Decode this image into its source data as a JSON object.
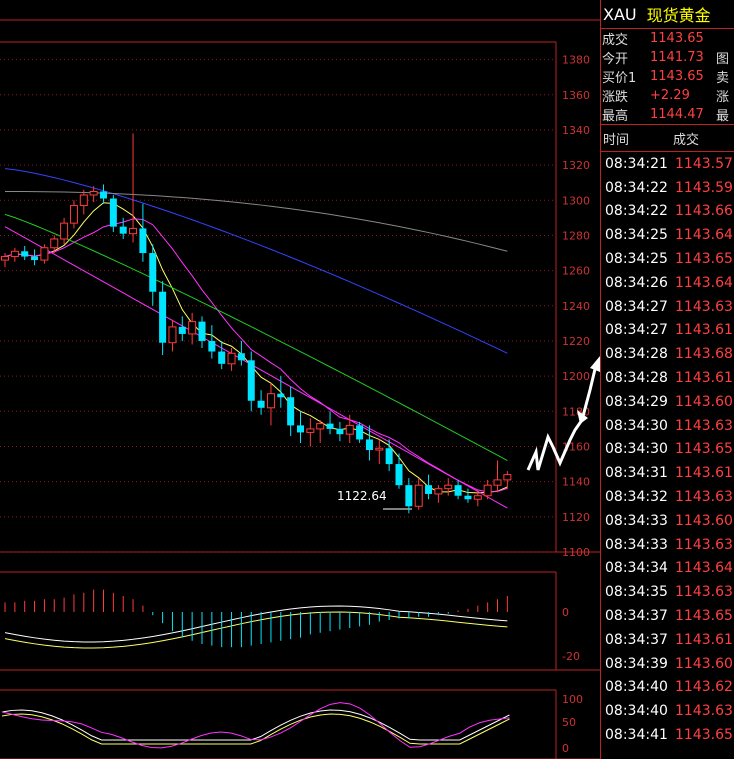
{
  "header": {
    "symbol": "XAU",
    "name": "现货黄金"
  },
  "quote": [
    {
      "label": "成交",
      "value": "1143.65",
      "cut": ""
    },
    {
      "label": "今开",
      "value": "1141.73",
      "cut": "图"
    },
    {
      "label": "买价1",
      "value": "1143.65",
      "cut": "卖"
    },
    {
      "label": "涨跌",
      "value": "+2.29",
      "cut": "涨"
    },
    {
      "label": "最高",
      "value": "1144.47",
      "cut": "最"
    }
  ],
  "ticks_header": {
    "time": "时间",
    "price": "成交"
  },
  "ticks": [
    {
      "time": "08:34:21",
      "price": "1143.57"
    },
    {
      "time": "08:34:22",
      "price": "1143.59"
    },
    {
      "time": "08:34:22",
      "price": "1143.66"
    },
    {
      "time": "08:34:25",
      "price": "1143.64"
    },
    {
      "time": "08:34:25",
      "price": "1143.65"
    },
    {
      "time": "08:34:26",
      "price": "1143.64"
    },
    {
      "time": "08:34:27",
      "price": "1143.63"
    },
    {
      "time": "08:34:27",
      "price": "1143.61"
    },
    {
      "time": "08:34:28",
      "price": "1143.68"
    },
    {
      "time": "08:34:28",
      "price": "1143.61"
    },
    {
      "time": "08:34:29",
      "price": "1143.60"
    },
    {
      "time": "08:34:30",
      "price": "1143.63"
    },
    {
      "time": "08:34:30",
      "price": "1143.65"
    },
    {
      "time": "08:34:31",
      "price": "1143.61"
    },
    {
      "time": "08:34:32",
      "price": "1143.63"
    },
    {
      "time": "08:34:33",
      "price": "1143.60"
    },
    {
      "time": "08:34:33",
      "price": "1143.63"
    },
    {
      "time": "08:34:34",
      "price": "1143.64"
    },
    {
      "time": "08:34:35",
      "price": "1143.63"
    },
    {
      "time": "08:34:37",
      "price": "1143.65"
    },
    {
      "time": "08:34:37",
      "price": "1143.61"
    },
    {
      "time": "08:34:39",
      "price": "1143.60"
    },
    {
      "time": "08:34:40",
      "price": "1143.62"
    },
    {
      "time": "08:34:40",
      "price": "1143.63"
    },
    {
      "time": "08:34:41",
      "price": "1143.65"
    }
  ],
  "chart": {
    "price_axis": [
      "1380",
      "1360",
      "1340",
      "1320",
      "1300",
      "1280",
      "1260",
      "1240",
      "1220",
      "1200",
      "1180",
      "1160",
      "1140",
      "1120",
      "1100"
    ],
    "low_label": "1122.64",
    "macd_axis": [
      "0",
      "-20"
    ],
    "kdj_axis": [
      "100",
      "50",
      "0"
    ],
    "colors": {
      "up": "#ff3b3b",
      "down": "#00e5ff",
      "ma5": "#ffffff",
      "ma10": "#ffff66",
      "ma20": "#ff33ff",
      "ma60": "#22cc22",
      "ma120": "#3344ff",
      "ma250": "#888888"
    }
  },
  "chart_data": {
    "type": "candlestick",
    "candles": [
      [
        1266,
        1270,
        1262,
        1268
      ],
      [
        1268,
        1273,
        1265,
        1271
      ],
      [
        1271,
        1274,
        1266,
        1268
      ],
      [
        1268,
        1272,
        1263,
        1266
      ],
      [
        1266,
        1275,
        1264,
        1273
      ],
      [
        1273,
        1280,
        1270,
        1278
      ],
      [
        1278,
        1290,
        1275,
        1287
      ],
      [
        1287,
        1300,
        1284,
        1297
      ],
      [
        1297,
        1306,
        1292,
        1303
      ],
      [
        1303,
        1308,
        1299,
        1305
      ],
      [
        1305,
        1309,
        1298,
        1301
      ],
      [
        1301,
        1303,
        1282,
        1285
      ],
      [
        1285,
        1290,
        1278,
        1281
      ],
      [
        1281,
        1338,
        1276,
        1284
      ],
      [
        1284,
        1298,
        1265,
        1270
      ],
      [
        1270,
        1275,
        1240,
        1248
      ],
      [
        1248,
        1254,
        1212,
        1219
      ],
      [
        1219,
        1232,
        1214,
        1228
      ],
      [
        1228,
        1234,
        1220,
        1224
      ],
      [
        1224,
        1236,
        1218,
        1231
      ],
      [
        1231,
        1234,
        1216,
        1220
      ],
      [
        1220,
        1229,
        1210,
        1214
      ],
      [
        1214,
        1220,
        1204,
        1207
      ],
      [
        1207,
        1216,
        1203,
        1213
      ],
      [
        1213,
        1220,
        1206,
        1209
      ],
      [
        1209,
        1214,
        1180,
        1186
      ],
      [
        1186,
        1192,
        1178,
        1182
      ],
      [
        1182,
        1196,
        1172,
        1190
      ],
      [
        1190,
        1200,
        1182,
        1188
      ],
      [
        1188,
        1194,
        1166,
        1172
      ],
      [
        1172,
        1180,
        1162,
        1168
      ],
      [
        1168,
        1176,
        1160,
        1170
      ],
      [
        1170,
        1175,
        1162,
        1173
      ],
      [
        1173,
        1180,
        1167,
        1170
      ],
      [
        1170,
        1174,
        1163,
        1167
      ],
      [
        1167,
        1178,
        1162,
        1172
      ],
      [
        1172,
        1174,
        1162,
        1164
      ],
      [
        1164,
        1172,
        1152,
        1158
      ],
      [
        1158,
        1164,
        1150,
        1159
      ],
      [
        1159,
        1164,
        1146,
        1150
      ],
      [
        1150,
        1156,
        1136,
        1138
      ],
      [
        1138,
        1142,
        1122,
        1126
      ],
      [
        1126,
        1142,
        1124,
        1138
      ],
      [
        1138,
        1144,
        1130,
        1133
      ],
      [
        1133,
        1138,
        1128,
        1136
      ],
      [
        1136,
        1142,
        1132,
        1138
      ],
      [
        1138,
        1141,
        1130,
        1132
      ],
      [
        1132,
        1136,
        1128,
        1130
      ],
      [
        1130,
        1135,
        1126,
        1132
      ],
      [
        1132,
        1141,
        1130,
        1138
      ],
      [
        1138,
        1152,
        1134,
        1141
      ],
      [
        1141,
        1146,
        1136,
        1144
      ]
    ],
    "macd_hist": [
      6,
      6,
      7,
      7,
      8,
      8,
      9,
      11,
      12,
      14,
      14,
      12,
      10,
      8,
      4,
      -2,
      -7,
      -12,
      -16,
      -18,
      -20,
      -21,
      -22,
      -22,
      -22,
      -21,
      -20,
      -19,
      -18,
      -17,
      -16,
      -14,
      -13,
      -12,
      -11,
      -10,
      -9,
      -8,
      -6,
      -5,
      -4,
      -4,
      -3,
      -3,
      -2,
      -1,
      1,
      2,
      4,
      6,
      8,
      10
    ],
    "ylim": [
      1100,
      1390
    ]
  }
}
